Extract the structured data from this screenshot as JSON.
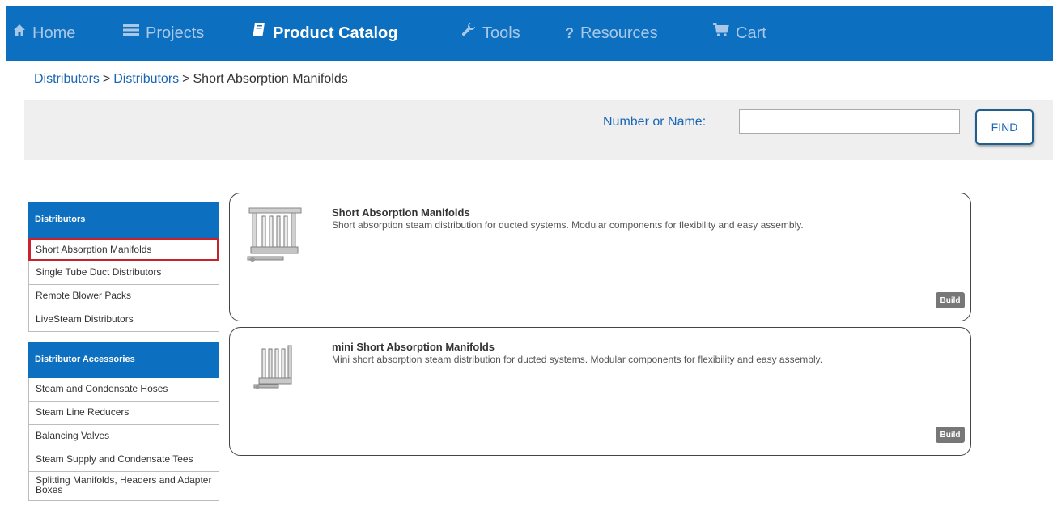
{
  "nav": {
    "items": [
      {
        "label": "Home",
        "icon": "home-icon"
      },
      {
        "label": "Projects",
        "icon": "list-icon"
      },
      {
        "label": "Product Catalog",
        "icon": "book-icon"
      },
      {
        "label": "Tools",
        "icon": "wrench-icon"
      },
      {
        "label": "Resources",
        "icon": "question-icon"
      },
      {
        "label": "Cart",
        "icon": "cart-icon"
      }
    ],
    "active": "Product Catalog",
    "colors": {
      "bar": "#0d6fbf",
      "active_text": "#ffffff",
      "inactive_text": "#a9c8e8"
    }
  },
  "breadcrumb": {
    "items": [
      "Distributors",
      "Distributors",
      "Short Absorption Manifolds"
    ],
    "separator": ">"
  },
  "search": {
    "label": "Number or Name:",
    "value": "",
    "button": "FIND"
  },
  "sidebar": {
    "sections": [
      {
        "title": "Distributors",
        "items": [
          "Short Absorption Manifolds",
          "Single Tube Duct Distributors",
          "Remote Blower Packs",
          "LiveSteam Distributors"
        ],
        "selected": "Short Absorption Manifolds"
      },
      {
        "title": "Distributor Accessories",
        "items": [
          "Steam and Condensate Hoses",
          "Steam Line Reducers",
          "Balancing Valves",
          "Steam Supply and Condensate Tees",
          "Splitting Manifolds, Headers and Adapter Boxes"
        ]
      }
    ],
    "colors": {
      "header": "#0d6fbf",
      "selected_border": "#c8232c"
    }
  },
  "products": [
    {
      "title": "Short Absorption Manifolds",
      "description": "Short absorption steam distribution for ducted systems. Modular components for flexibility and easy assembly.",
      "button": "Build"
    },
    {
      "title": "mini Short Absorption Manifolds",
      "description": "Mini short absorption steam distribution for ducted systems. Modular components for flexibility and easy assembly.",
      "button": "Build"
    }
  ]
}
